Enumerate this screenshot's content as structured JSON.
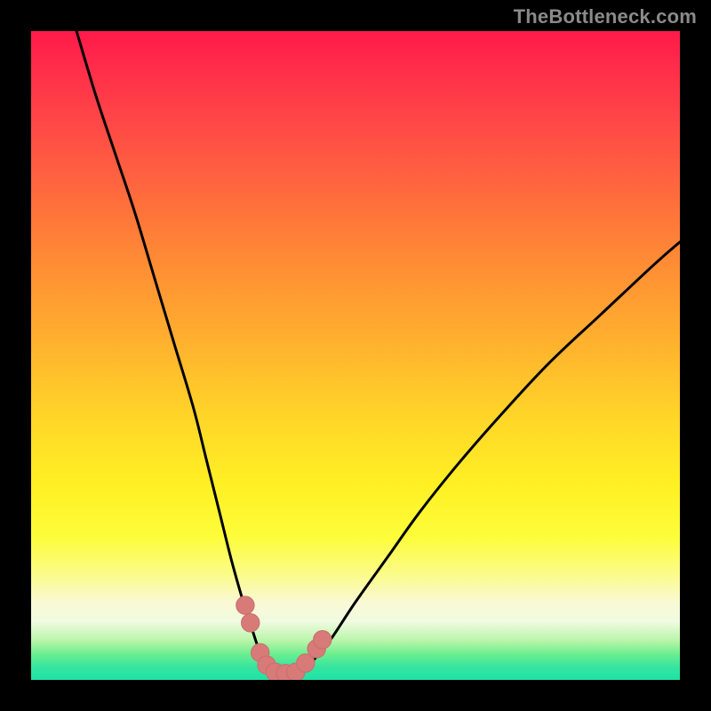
{
  "watermark": "TheBottleneck.com",
  "colors": {
    "frame": "#000000",
    "curve": "#000000",
    "markers_fill": "#d77a78",
    "markers_stroke": "#c96f6e",
    "gradient_top": "#ff1a4a",
    "gradient_bottom": "#1fe2a8"
  },
  "chart_data": {
    "type": "line",
    "title": "",
    "xlabel": "",
    "ylabel": "",
    "xlim": [
      0,
      100
    ],
    "ylim": [
      0,
      100
    ],
    "grid": false,
    "legend": false,
    "series": [
      {
        "name": "bottleneck-curve",
        "x": [
          7,
          10,
          13,
          16,
          19,
          22,
          25,
          27,
          29,
          31,
          33,
          34,
          35,
          36,
          37,
          38,
          39.5,
          41,
          43,
          46,
          50,
          55,
          60,
          66,
          73,
          80,
          88,
          96,
          100
        ],
        "y": [
          100,
          90,
          81,
          72,
          62,
          52,
          42,
          34,
          26,
          18,
          11,
          8,
          5,
          3,
          1,
          0,
          0,
          0.7,
          2.5,
          6,
          12,
          19,
          26,
          33.5,
          41.5,
          49,
          56.5,
          64,
          67.5
        ],
        "note": "values are in percent of plot width/height; y measured from bottom"
      }
    ],
    "markers": {
      "name": "highlighted-points",
      "shape": "circle",
      "radius_pct": 1.4,
      "points_xy_pct": [
        [
          33.0,
          11.5
        ],
        [
          33.8,
          8.8
        ],
        [
          35.3,
          4.2
        ],
        [
          36.3,
          2.3
        ],
        [
          37.6,
          1.2
        ],
        [
          39.2,
          1.0
        ],
        [
          40.8,
          1.2
        ],
        [
          42.3,
          2.6
        ],
        [
          44.0,
          4.8
        ],
        [
          44.9,
          6.2
        ]
      ],
      "note": "pink dots near the valley floor"
    }
  }
}
